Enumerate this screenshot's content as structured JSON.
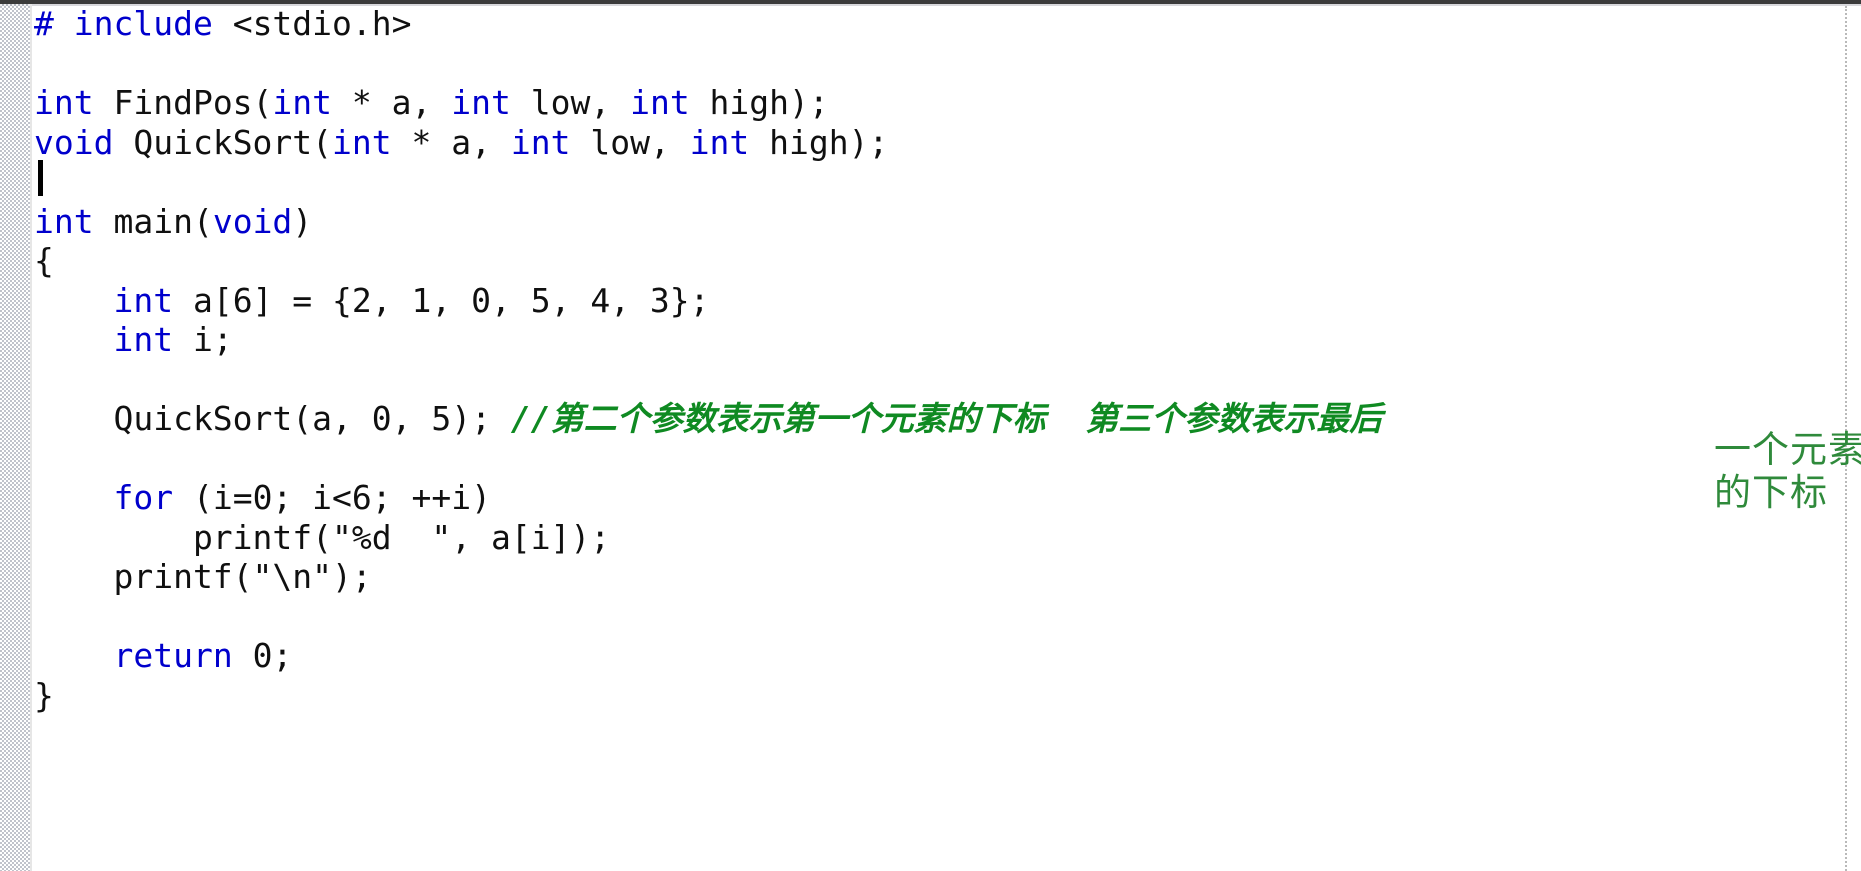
{
  "editor": {
    "app": "code-editor",
    "language": "c",
    "background_color": "#ffffff",
    "keyword_color": "#0000cc",
    "text_color": "#101010",
    "comment_color": "#0f8a22",
    "annotation_color": "#2f8a3b",
    "gutter_color": "#9aa0ac",
    "caret_visible": true
  },
  "code_lines": [
    {
      "n": 1,
      "segments": [
        {
          "t": "#",
          "k": "kw"
        },
        {
          "t": " ",
          "k": "plain"
        },
        {
          "t": "include",
          "k": "kw"
        },
        {
          "t": " <stdio.h>",
          "k": "plain"
        }
      ]
    },
    {
      "n": 2,
      "segments": [
        {
          "t": "",
          "k": "plain"
        }
      ]
    },
    {
      "n": 3,
      "segments": [
        {
          "t": "int",
          "k": "kw"
        },
        {
          "t": " FindPos(",
          "k": "plain"
        },
        {
          "t": "int",
          "k": "kw"
        },
        {
          "t": " * a, ",
          "k": "plain"
        },
        {
          "t": "int",
          "k": "kw"
        },
        {
          "t": " low, ",
          "k": "plain"
        },
        {
          "t": "int",
          "k": "kw"
        },
        {
          "t": " high);",
          "k": "plain"
        }
      ]
    },
    {
      "n": 4,
      "segments": [
        {
          "t": "void",
          "k": "kw"
        },
        {
          "t": " QuickSort(",
          "k": "plain"
        },
        {
          "t": "int",
          "k": "kw"
        },
        {
          "t": " * a, ",
          "k": "plain"
        },
        {
          "t": "int",
          "k": "kw"
        },
        {
          "t": " low, ",
          "k": "plain"
        },
        {
          "t": "int",
          "k": "kw"
        },
        {
          "t": " high);",
          "k": "plain"
        }
      ]
    },
    {
      "n": 5,
      "segments": [
        {
          "t": "",
          "k": "plain"
        }
      ]
    },
    {
      "n": 6,
      "segments": [
        {
          "t": "int",
          "k": "kw"
        },
        {
          "t": " main(",
          "k": "plain"
        },
        {
          "t": "void",
          "k": "kw"
        },
        {
          "t": ")",
          "k": "plain"
        }
      ]
    },
    {
      "n": 7,
      "segments": [
        {
          "t": "{",
          "k": "plain"
        }
      ]
    },
    {
      "n": 8,
      "segments": [
        {
          "t": "    ",
          "k": "plain"
        },
        {
          "t": "int",
          "k": "kw"
        },
        {
          "t": " a[6] = {2, 1, 0, 5, 4, 3};",
          "k": "plain"
        }
      ]
    },
    {
      "n": 9,
      "segments": [
        {
          "t": "    ",
          "k": "plain"
        },
        {
          "t": "int",
          "k": "kw"
        },
        {
          "t": " i;",
          "k": "plain"
        }
      ]
    },
    {
      "n": 10,
      "segments": [
        {
          "t": "",
          "k": "plain"
        }
      ]
    },
    {
      "n": 11,
      "segments": [
        {
          "t": "    QuickSort(a, 0, 5); ",
          "k": "plain"
        },
        {
          "t": "//第二个参数表示第一个元素的下标  第三个参数表示最后",
          "k": "cmt"
        }
      ]
    },
    {
      "n": 12,
      "segments": [
        {
          "t": "",
          "k": "plain"
        }
      ]
    },
    {
      "n": 13,
      "segments": [
        {
          "t": "    ",
          "k": "plain"
        },
        {
          "t": "for",
          "k": "kw"
        },
        {
          "t": " (i=0; i<6; ++i)",
          "k": "plain"
        }
      ]
    },
    {
      "n": 14,
      "segments": [
        {
          "t": "        printf(\"%d  \", a[i]);",
          "k": "plain"
        }
      ]
    },
    {
      "n": 15,
      "segments": [
        {
          "t": "    printf(\"\\n\");",
          "k": "plain"
        }
      ]
    },
    {
      "n": 16,
      "segments": [
        {
          "t": "",
          "k": "plain"
        }
      ]
    },
    {
      "n": 17,
      "segments": [
        {
          "t": "    ",
          "k": "plain"
        },
        {
          "t": "return",
          "k": "kw"
        },
        {
          "t": " 0;",
          "k": "plain"
        }
      ]
    },
    {
      "n": 18,
      "segments": [
        {
          "t": "}",
          "k": "plain"
        }
      ]
    }
  ],
  "annotation": {
    "line_1": "一个元素",
    "line_2": "的下标"
  }
}
